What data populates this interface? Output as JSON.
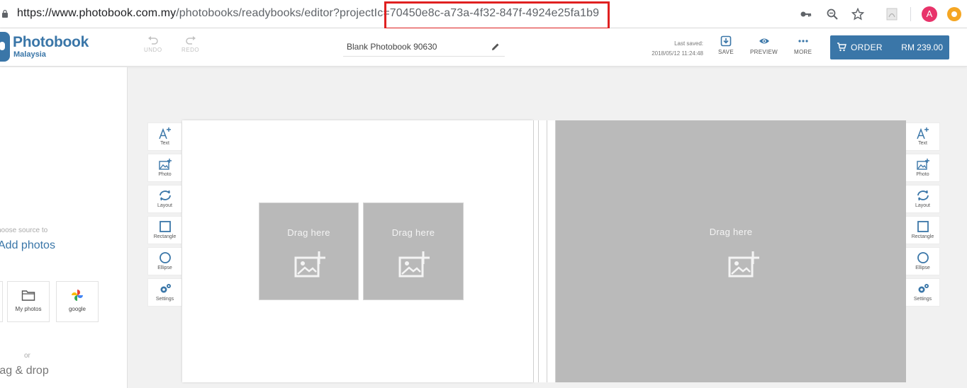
{
  "browser": {
    "url_host_part": "https://www.photobook.com.my",
    "url_path_part": "/photobooks/readybooks/editor?projectIc",
    "url_query_part": "=70450e8c-a73a-4f32-847f-4924e25fa1b9",
    "profile_initial": "A"
  },
  "header": {
    "logo_title": "Photobook",
    "logo_subtitle": "Malaysia",
    "undo_label": "UNDO",
    "redo_label": "REDO",
    "project_title": "Blank Photobook 90630",
    "last_saved_label": "Last saved:",
    "last_saved_time": "2018/05/12 11:24:48",
    "save_label": "SAVE",
    "preview_label": "PREVIEW",
    "more_label": "MORE",
    "order_label": "ORDER",
    "order_price": "RM 239.00"
  },
  "left_panel": {
    "choose_source": "hoose source to",
    "add_photos": "Add photos",
    "sources": [
      {
        "label": "My photos",
        "icon": "folder-icon"
      },
      {
        "label": "google",
        "icon": "google-photos-icon"
      }
    ],
    "or_text": "or",
    "drag_drop": "rag & drop"
  },
  "tools": [
    {
      "label": "Text",
      "icon": "text-add-icon"
    },
    {
      "label": "Photo",
      "icon": "photo-add-icon"
    },
    {
      "label": "Layout",
      "icon": "layout-refresh-icon"
    },
    {
      "label": "Rectangle",
      "icon": "rectangle-icon"
    },
    {
      "label": "Ellipse",
      "icon": "ellipse-icon"
    },
    {
      "label": "Settings",
      "icon": "settings-icon"
    }
  ],
  "canvas": {
    "drag_here": "Drag here"
  },
  "colors": {
    "brand": "#3a76a8",
    "highlight": "#e02020",
    "placeholder_gray": "#bababa"
  }
}
